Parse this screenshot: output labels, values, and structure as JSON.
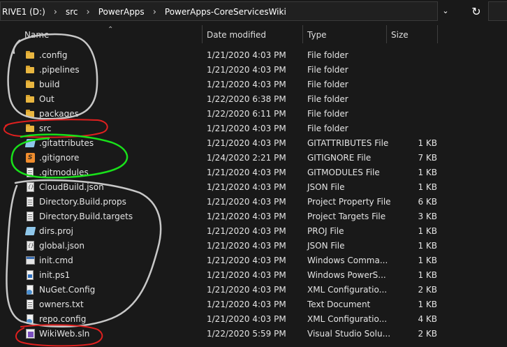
{
  "address": {
    "crumbs": [
      "RIVE1 (D:)",
      "src",
      "PowerApps",
      "PowerApps-CoreServicesWiki"
    ],
    "dropdown_icon": "chevron-down-icon",
    "refresh_icon": "refresh-icon"
  },
  "columns": {
    "name": "Name",
    "date": "Date modified",
    "type": "Type",
    "size": "Size",
    "sort_icon": "sort-ascending-icon"
  },
  "rows": [
    {
      "icon": "folder-icon",
      "name": ".config",
      "date": "1/21/2020 4:03 PM",
      "type": "File folder",
      "size": ""
    },
    {
      "icon": "folder-icon",
      "name": ".pipelines",
      "date": "1/21/2020 4:03 PM",
      "type": "File folder",
      "size": ""
    },
    {
      "icon": "folder-icon",
      "name": "build",
      "date": "1/21/2020 4:03 PM",
      "type": "File folder",
      "size": ""
    },
    {
      "icon": "folder-icon",
      "name": "Out",
      "date": "1/22/2020 6:38 PM",
      "type": "File folder",
      "size": ""
    },
    {
      "icon": "folder-icon",
      "name": "packages",
      "date": "1/22/2020 6:11 PM",
      "type": "File folder",
      "size": ""
    },
    {
      "icon": "folder-icon",
      "name": "src",
      "date": "1/21/2020 4:03 PM",
      "type": "File folder",
      "size": ""
    },
    {
      "icon": "proj-icon",
      "name": ".gitattributes",
      "date": "1/21/2020 4:03 PM",
      "type": "GITATTRIBUTES File",
      "size": "1 KB"
    },
    {
      "icon": "sublime-icon",
      "name": ".gitignore",
      "date": "1/24/2020 2:21 PM",
      "type": "GITIGNORE File",
      "size": "7 KB"
    },
    {
      "icon": "doc-icon",
      "name": ".gitmodules",
      "date": "1/21/2020 4:03 PM",
      "type": "GITMODULES File",
      "size": "1 KB"
    },
    {
      "icon": "json-icon",
      "name": "CloudBuild.json",
      "date": "1/21/2020 4:03 PM",
      "type": "JSON File",
      "size": "1 KB"
    },
    {
      "icon": "doc-icon",
      "name": "Directory.Build.props",
      "date": "1/21/2020 4:03 PM",
      "type": "Project Property File",
      "size": "6 KB"
    },
    {
      "icon": "doc-icon",
      "name": "Directory.Build.targets",
      "date": "1/21/2020 4:03 PM",
      "type": "Project Targets File",
      "size": "3 KB"
    },
    {
      "icon": "proj-icon",
      "name": "dirs.proj",
      "date": "1/21/2020 4:03 PM",
      "type": "PROJ File",
      "size": "1 KB"
    },
    {
      "icon": "json-icon",
      "name": "global.json",
      "date": "1/21/2020 4:03 PM",
      "type": "JSON File",
      "size": "1 KB"
    },
    {
      "icon": "cmd-icon",
      "name": "init.cmd",
      "date": "1/21/2020 4:03 PM",
      "type": "Windows Comma...",
      "size": "1 KB"
    },
    {
      "icon": "ps-icon",
      "name": "init.ps1",
      "date": "1/21/2020 4:03 PM",
      "type": "Windows PowerS...",
      "size": "1 KB"
    },
    {
      "icon": "xml-icon",
      "name": "NuGet.Config",
      "date": "1/21/2020 4:03 PM",
      "type": "XML Configuratio...",
      "size": "2 KB"
    },
    {
      "icon": "doc-icon",
      "name": "owners.txt",
      "date": "1/21/2020 4:03 PM",
      "type": "Text Document",
      "size": "1 KB"
    },
    {
      "icon": "xml-icon",
      "name": "repo.config",
      "date": "1/21/2020 4:03 PM",
      "type": "XML Configuratio...",
      "size": "4 KB"
    },
    {
      "icon": "sln-icon",
      "name": "WikiWeb.sln",
      "date": "1/22/2020 5:59 PM",
      "type": "Visual Studio Solu...",
      "size": "2 KB"
    }
  ],
  "colors": {
    "background": "#191919",
    "annotation_gray": "#c8c8c8",
    "annotation_red": "#e0201f",
    "annotation_green": "#19e01a"
  }
}
